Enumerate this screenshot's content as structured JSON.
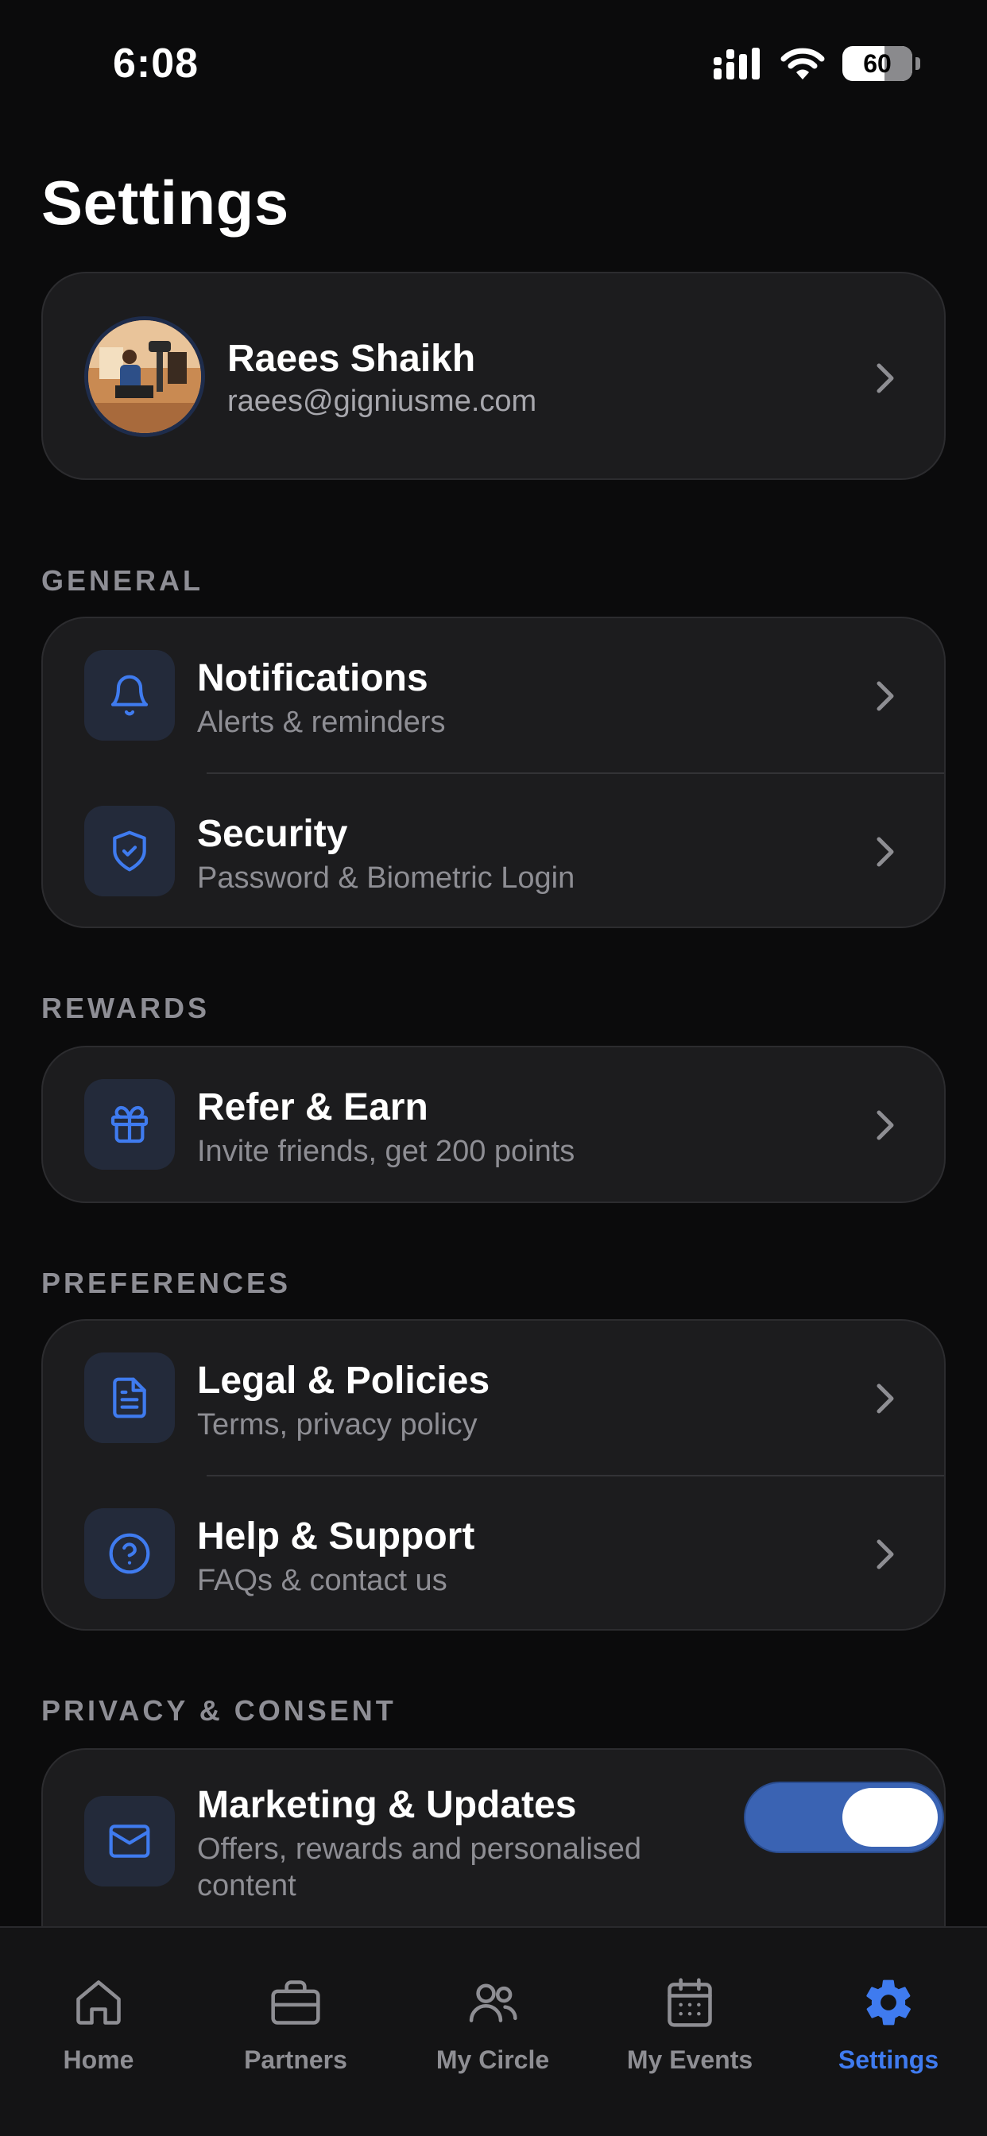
{
  "status_bar": {
    "time": "6:08",
    "battery": "60"
  },
  "page_title": "Settings",
  "profile": {
    "name": "Raees Shaikh",
    "email": "raees@gigniusme.com"
  },
  "sections": {
    "general": {
      "label": "GENERAL",
      "items": [
        {
          "title": "Notifications",
          "subtitle": "Alerts & reminders",
          "icon": "bell-icon"
        },
        {
          "title": "Security",
          "subtitle": "Password & Biometric Login",
          "icon": "shield-check-icon"
        }
      ]
    },
    "rewards": {
      "label": "REWARDS",
      "items": [
        {
          "title": "Refer & Earn",
          "subtitle": "Invite friends, get 200 points",
          "icon": "gift-icon"
        }
      ]
    },
    "preferences": {
      "label": "PREFERENCES",
      "items": [
        {
          "title": "Legal & Policies",
          "subtitle": "Terms, privacy policy",
          "icon": "document-icon"
        },
        {
          "title": "Help & Support",
          "subtitle": "FAQs & contact us",
          "icon": "help-circle-icon"
        }
      ]
    },
    "privacy": {
      "label": "PRIVACY & CONSENT",
      "items": [
        {
          "title": "Marketing & Updates",
          "subtitle_line1": "Offers, rewards and personalised",
          "subtitle_line2": "content",
          "icon": "mail-icon",
          "toggle_on": true
        }
      ]
    }
  },
  "tab_bar": {
    "tabs": [
      {
        "label": "Home",
        "icon": "home-icon"
      },
      {
        "label": "Partners",
        "icon": "briefcase-icon"
      },
      {
        "label": "My Circle",
        "icon": "users-icon"
      },
      {
        "label": "My Events",
        "icon": "calendar-icon"
      },
      {
        "label": "Settings",
        "icon": "gear-icon",
        "active": true
      }
    ]
  },
  "colors": {
    "accent": "#3f7bef",
    "background": "#0b0b0c",
    "card": "#1c1c1e",
    "toggle_on": "#3a63b3"
  }
}
